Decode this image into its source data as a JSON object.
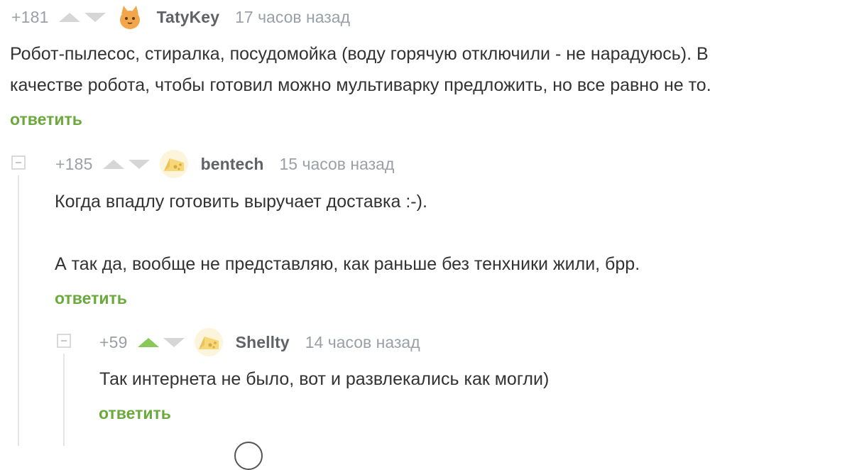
{
  "thread": {
    "comments": [
      {
        "rating": "+181",
        "up_active": false,
        "avatar": "cat-avatar-icon",
        "username": "TatyKey",
        "time": "17 часов назад",
        "text_lines": [
          "Робот-пылесос, стиралка, посудомойка (воду горячую отключили - не нарадуюсь). В",
          "качестве робота, чтобы готовил можно мультиварку предложить, но все равно не то."
        ],
        "reply_label": "ответить"
      },
      {
        "rating": "+185",
        "up_active": false,
        "avatar": "cheese-avatar-icon",
        "username": "bentech",
        "time": "15 часов назад",
        "text_lines": [
          "Когда впадлу готовить выручает доставка :-).",
          "",
          "А так да, вообще не представляю, как раньше без тенхники жили, брр."
        ],
        "reply_label": "ответить"
      },
      {
        "rating": "+59",
        "up_active": true,
        "avatar": "cheese-avatar-icon",
        "username": "Shellty",
        "time": "14 часов назад",
        "text_lines": [
          "Так интернета не было, вот и развлекались как могли)"
        ],
        "reply_label": "ответить"
      }
    ]
  },
  "colors": {
    "accent_green": "#6aaa3c",
    "upvote_active": "#8ac858",
    "meta_gray": "#9aa0a6",
    "text": "#333333"
  }
}
